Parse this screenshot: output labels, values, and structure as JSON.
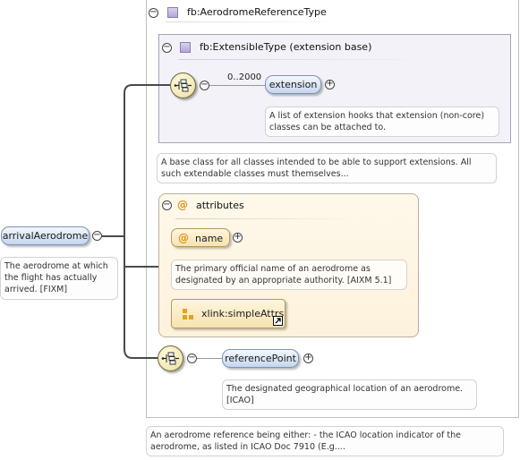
{
  "root_element": {
    "name": "arrivalAerodrome",
    "doc": "The aerodrome at which the flight has actually arrived. [FIXM]"
  },
  "complex_type": {
    "name": "fb:AerodromeReferenceType",
    "doc": "An aerodrome reference being either: - the ICAO location indicator of the aerodrome, as listed in ICAO Doc 7910 (E.g...."
  },
  "extensible_type": {
    "name": "fb:ExtensibleType (extension base)",
    "doc": "A base class for all classes intended to be able to support extensions. All such extendable classes must themselves...",
    "sequence": {
      "cardinality": "0..2000",
      "element": "extension",
      "element_doc": "A list of extension hooks that extension (non-core) classes can be attached to."
    }
  },
  "attributes": {
    "label": "attributes",
    "at_symbol": "@",
    "name_attr": "name",
    "name_doc": "The primary official name of an aerodrome as designated by an appropriate authority. [AIXM 5.1]",
    "group": "xlink:simpleAttrs"
  },
  "reference_point": {
    "element": "referencePoint",
    "doc": "The designated geographical location of an aerodrome. [ICAO]"
  },
  "toggles": {
    "collapse": "−",
    "expand": "+"
  },
  "colors": {
    "element_fill": "#c5d6ee",
    "type_panel": "#f3f2f8",
    "attributes_panel": "#fdf2dc",
    "sequence_fill": "#ecdca0"
  }
}
